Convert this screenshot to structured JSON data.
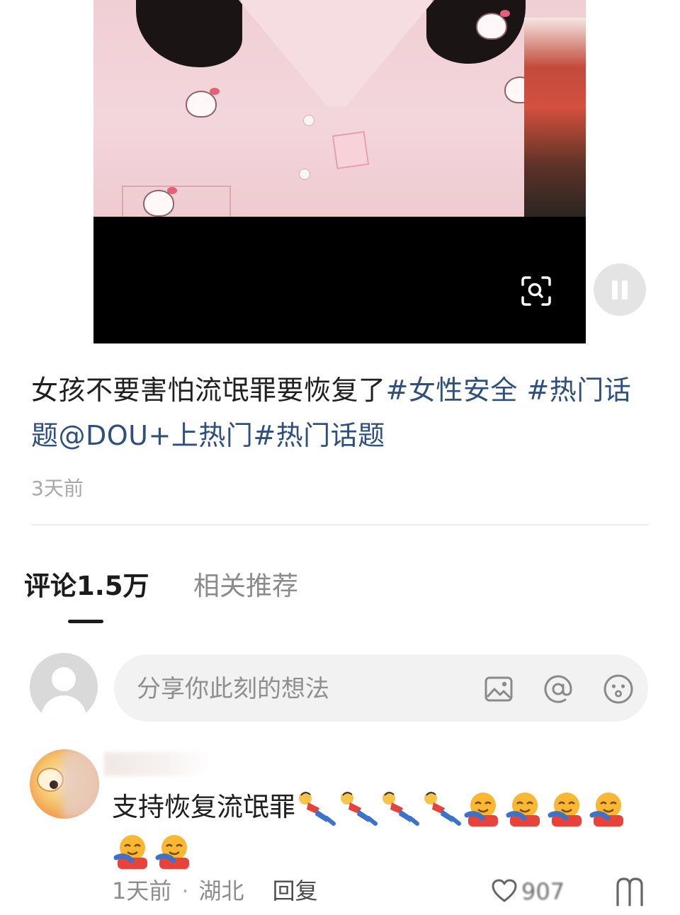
{
  "video": {
    "scan_icon": "scan-search-icon",
    "pause_icon": "pause-icon"
  },
  "caption": {
    "text": "女孩不要害怕流氓罪要恢复了",
    "hashtag_1": "#女性安全",
    "hashtag_2": "#热门话题",
    "mention": "@DOU+上热门",
    "hashtag_3": "#热门话题"
  },
  "post_time": "3天前",
  "tabs": [
    {
      "label": "评论1.5万",
      "active": true
    },
    {
      "label": "相关推荐",
      "active": false
    }
  ],
  "comment_input": {
    "placeholder": "分享你此刻的想法",
    "icons": [
      "image-icon",
      "at-mention-icon",
      "emoji-icon"
    ]
  },
  "comment": {
    "text": "支持恢复流氓罪",
    "emoji_sequence": [
      "kneeling-person-emoji",
      "kneeling-person-emoji",
      "kneeling-person-emoji",
      "kneeling-person-emoji",
      "hugging-face-emoji",
      "hugging-face-emoji",
      "hugging-face-emoji",
      "hugging-face-emoji",
      "hugging-face-emoji",
      "hugging-face-emoji"
    ],
    "time": "1天前",
    "location": "湖北",
    "reply_label": "回复",
    "like_count": "907"
  },
  "colors": {
    "link": "#2f4f7f",
    "muted": "#a8a8a8",
    "input_bg": "#f2f2f2"
  }
}
